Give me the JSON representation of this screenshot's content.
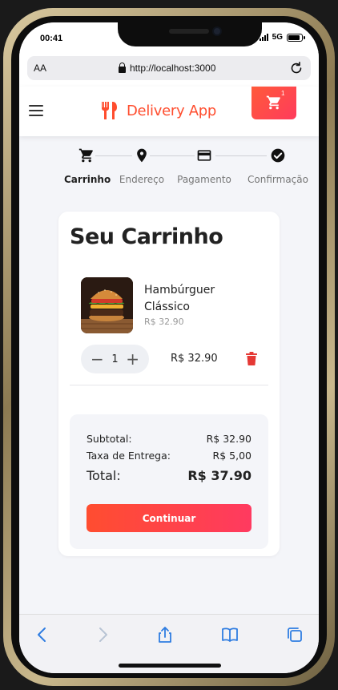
{
  "status": {
    "time": "00:41",
    "network": "5G",
    "battery_level": 0.9
  },
  "browser": {
    "aa_label": "AA",
    "url": "http://localhost:3000"
  },
  "header": {
    "app_name": "Delivery App",
    "cart_count": "1"
  },
  "steps": [
    {
      "label": "Carrinho",
      "icon": "cart-icon",
      "active": true
    },
    {
      "label": "Endereço",
      "icon": "location-pin-icon",
      "active": false
    },
    {
      "label": "Pagamento",
      "icon": "credit-card-icon",
      "active": false
    },
    {
      "label": "Confirmação",
      "icon": "check-circle-icon",
      "active": false
    }
  ],
  "cart": {
    "title": "Seu Carrinho",
    "items": [
      {
        "name": "Hambúrguer Clássico",
        "unit_price": "R$ 32.90",
        "quantity": "1",
        "line_total": "R$ 32.90",
        "image": "burger-photo"
      }
    ],
    "summary": {
      "subtotal_label": "Subtotal:",
      "subtotal_value": "R$ 32.90",
      "delivery_label": "Taxa de Entrega:",
      "delivery_value": "R$ 5,00",
      "total_label": "Total:",
      "total_value": "R$ 37.90"
    },
    "continue_label": "Continuar"
  },
  "colors": {
    "accent": "#ff4d2e",
    "accent_end": "#ff3b5c",
    "trash": "#e53935"
  },
  "toolbar_icons": [
    "back-icon",
    "forward-icon",
    "share-icon",
    "bookmarks-icon",
    "tabs-icon"
  ]
}
